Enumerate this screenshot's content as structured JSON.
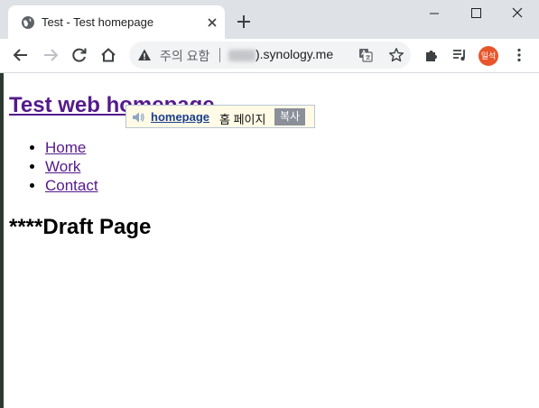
{
  "browser": {
    "tab": {
      "title": "Test - Test homepage"
    },
    "address": {
      "security_label": "주의 요함",
      "host_suffix": ").synology.me"
    },
    "profile_label": "일석"
  },
  "page": {
    "site_title": "Test web homepage",
    "nav": [
      {
        "label": "Home"
      },
      {
        "label": "Work"
      },
      {
        "label": "Contact"
      }
    ],
    "heading": "****Draft Page"
  },
  "dictionary_popup": {
    "word": "homepage",
    "meaning": "홈 페이지",
    "copy_label": "복사"
  },
  "colors": {
    "visited_link": "#551a8b",
    "profile": "#e8552b"
  }
}
